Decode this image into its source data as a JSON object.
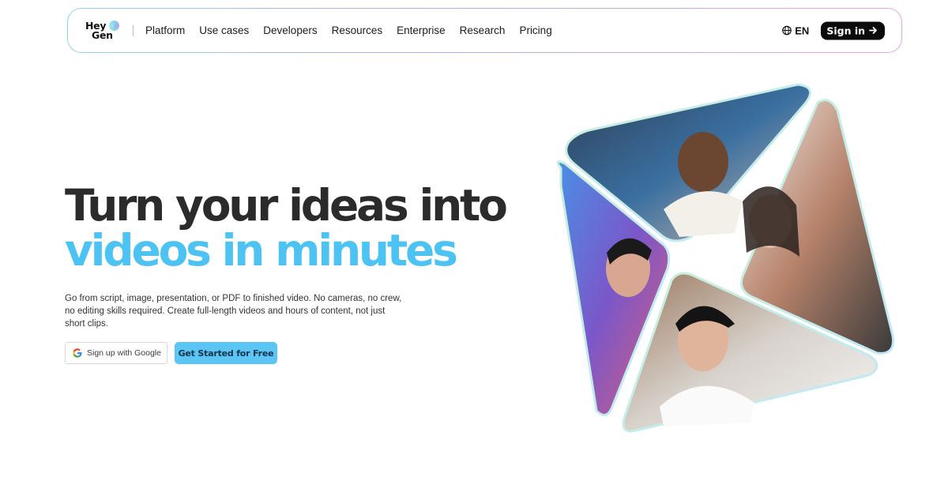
{
  "brand": {
    "logo_line1": "Hey",
    "logo_line2": "Gen"
  },
  "nav": {
    "links": [
      "Platform",
      "Use cases",
      "Developers",
      "Resources",
      "Enterprise",
      "Research",
      "Pricing"
    ],
    "language": "EN",
    "signin_label": "Sign in"
  },
  "hero": {
    "title_line1": "Turn your ideas into",
    "title_line2": "videos in minutes",
    "subtitle": "Go from script, image, presentation, or PDF to finished video. No cameras, no crew, no editing skills required. Create full-length videos and hours of content, not just short clips.",
    "google_button": "Sign up with Google",
    "cta_button": "Get Started for Free"
  },
  "icons": {
    "globe": "globe-icon",
    "arrow": "arrow-right-icon",
    "google": "google-icon"
  },
  "colors": {
    "accent": "#4cc3f2",
    "cta": "#5bc6f5",
    "dark": "#0b0b0b"
  }
}
